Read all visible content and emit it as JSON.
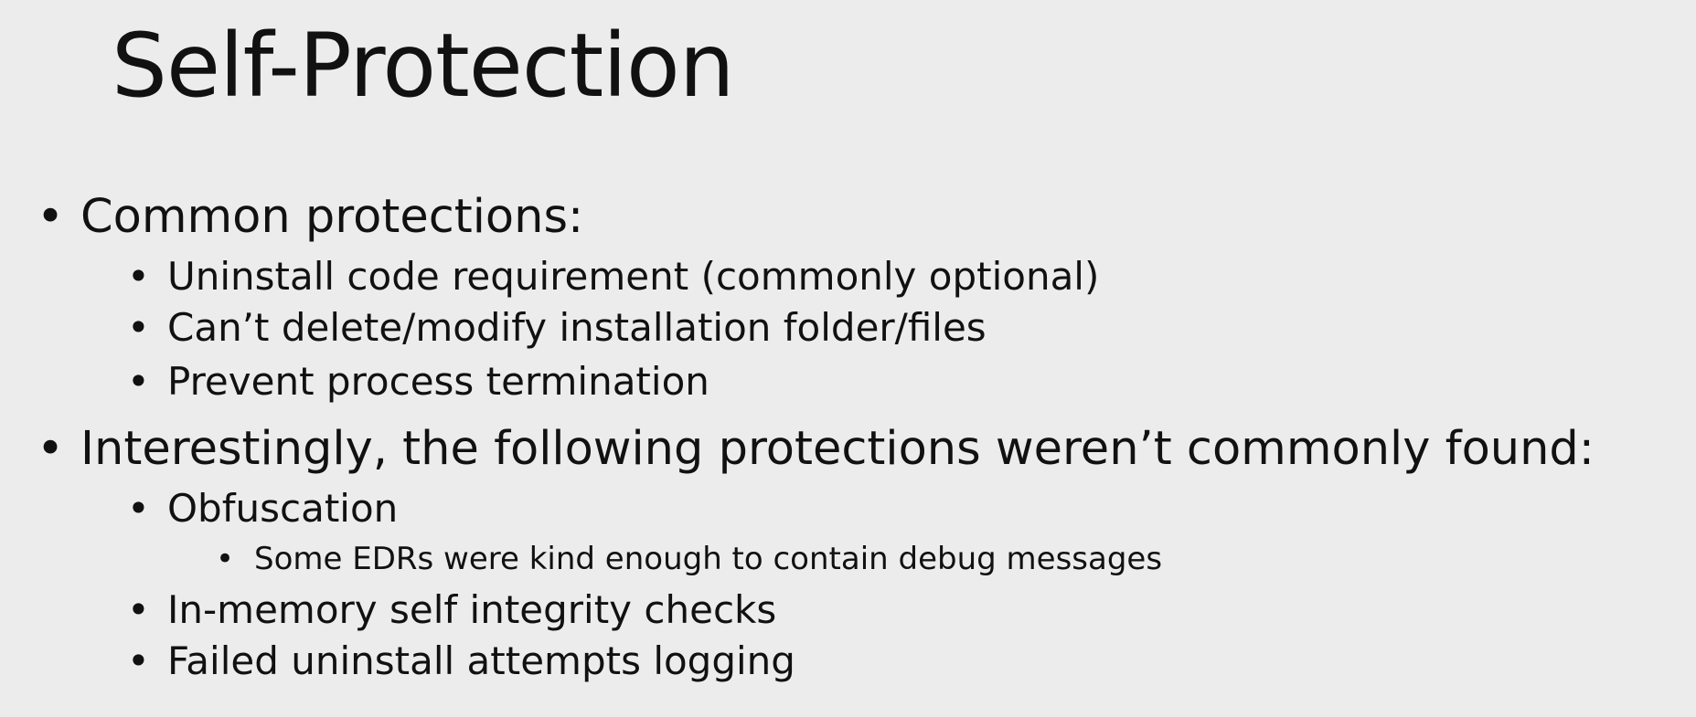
{
  "slide": {
    "title": "Self-Protection",
    "bullet_glyph": "•",
    "bullets": [
      {
        "level": 1,
        "text": "Common protections:"
      },
      {
        "level": 2,
        "text": "Uninstall code requirement (commonly optional)"
      },
      {
        "level": 2,
        "text": "Can’t delete/modify installation folder/files"
      },
      {
        "level": 2,
        "text": "Prevent process termination"
      },
      {
        "level": 1,
        "text": "Interestingly, the following protections weren’t commonly found:"
      },
      {
        "level": 2,
        "text": "Obfuscation"
      },
      {
        "level": 3,
        "text": "Some EDRs were kind enough to contain debug messages"
      },
      {
        "level": 2,
        "text": "In-memory self integrity checks"
      },
      {
        "level": 2,
        "text": "Failed uninstall attempts logging"
      }
    ]
  }
}
